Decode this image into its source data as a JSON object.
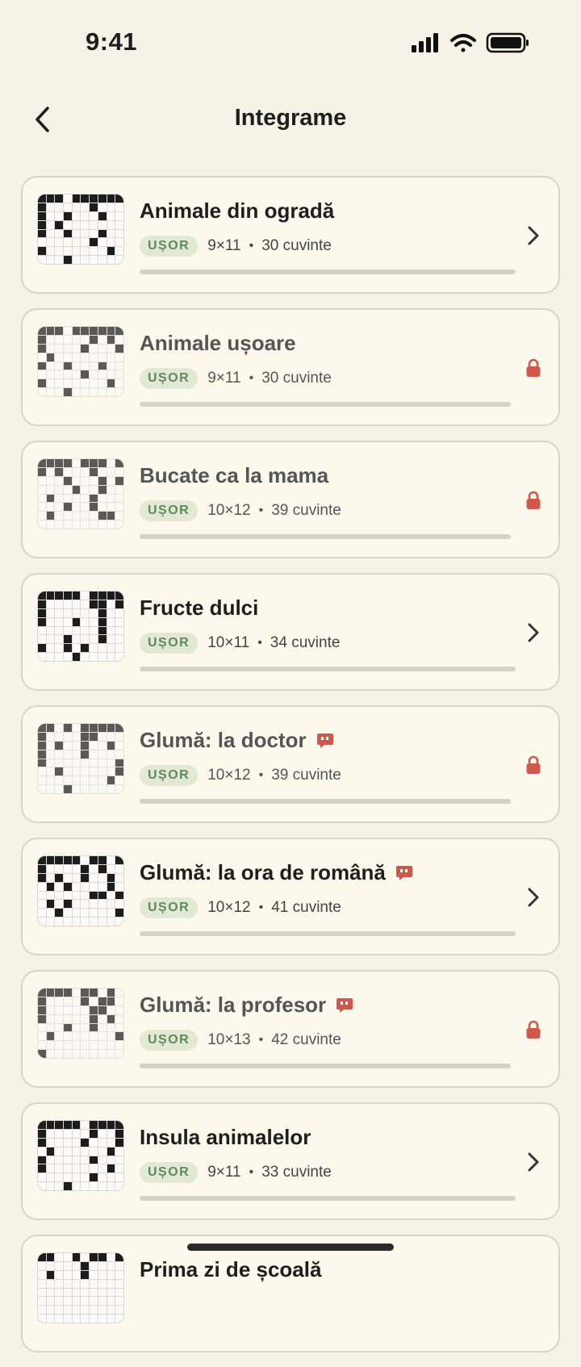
{
  "status_bar": {
    "time": "9:41"
  },
  "header": {
    "title": "Integrame"
  },
  "colors": {
    "background": "#f6f2e6",
    "card": "#fcf8eb",
    "lock": "#d2574b",
    "badge_text": "#5d8a5a",
    "joke_icon": "#d2574b"
  },
  "puzzles": [
    {
      "title": "Animale din ogradă",
      "difficulty": "UȘOR",
      "size": "9×11",
      "words": "30 cuvinte",
      "locked": false,
      "joke": false,
      "icon": "chevron-right-icon"
    },
    {
      "title": "Animale ușoare",
      "difficulty": "UȘOR",
      "size": "9×11",
      "words": "30 cuvinte",
      "locked": true,
      "joke": false,
      "icon": "lock-icon"
    },
    {
      "title": "Bucate ca la mama",
      "difficulty": "UȘOR",
      "size": "10×12",
      "words": "39 cuvinte",
      "locked": true,
      "joke": false,
      "icon": "lock-icon"
    },
    {
      "title": "Fructe dulci",
      "difficulty": "UȘOR",
      "size": "10×11",
      "words": "34 cuvinte",
      "locked": false,
      "joke": false,
      "icon": "chevron-right-icon"
    },
    {
      "title": "Glumă: la doctor",
      "difficulty": "UȘOR",
      "size": "10×12",
      "words": "39 cuvinte",
      "locked": true,
      "joke": true,
      "icon": "lock-icon"
    },
    {
      "title": "Glumă: la ora de română",
      "difficulty": "UȘOR",
      "size": "10×12",
      "words": "41 cuvinte",
      "locked": false,
      "joke": true,
      "icon": "chevron-right-icon"
    },
    {
      "title": "Glumă: la profesor",
      "difficulty": "UȘOR",
      "size": "10×13",
      "words": "42 cuvinte",
      "locked": true,
      "joke": true,
      "icon": "lock-icon"
    },
    {
      "title": "Insula animalelor",
      "difficulty": "UȘOR",
      "size": "9×11",
      "words": "33 cuvinte",
      "locked": false,
      "joke": false,
      "icon": "chevron-right-icon"
    },
    {
      "title": "Prima zi de școală",
      "difficulty": "UȘOR",
      "size": "",
      "words": "",
      "locked": false,
      "joke": false,
      "icon": "chevron-right-icon"
    }
  ]
}
